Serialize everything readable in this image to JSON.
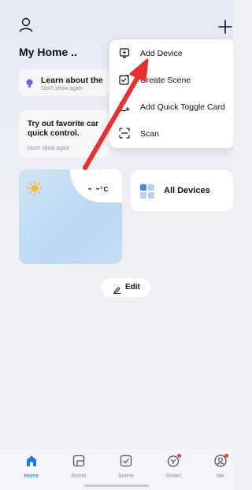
{
  "header": {
    "home_title": "My Home ..",
    "profile_icon": "user-icon",
    "add_icon": "plus-icon"
  },
  "learn_card": {
    "title": "Learn about the",
    "subtitle": "Don't show again",
    "icon": "lightbulb-icon"
  },
  "favorites_card": {
    "title_line1": "Try out favorite car",
    "title_line2": "quick control.",
    "subtitle": "Don't show again"
  },
  "weather": {
    "temperature": "- -",
    "unit": "°C",
    "dash1": "- -",
    "dash2": "- -",
    "icon": "sun-icon"
  },
  "all_devices": {
    "label": "All Devices",
    "icon": "grid-icon"
  },
  "edit": {
    "label": "Edit",
    "icon": "pencil-icon"
  },
  "menu": {
    "items": [
      {
        "label": "Add Device",
        "icon": "add-device-icon"
      },
      {
        "label": "Create Scene",
        "icon": "create-scene-icon"
      },
      {
        "label": "Add Quick Toggle Card",
        "icon": "quick-toggle-icon"
      },
      {
        "label": "Scan",
        "icon": "scan-icon"
      }
    ]
  },
  "tabs": [
    {
      "label": "Home",
      "icon": "home-icon",
      "active": true
    },
    {
      "label": "Room",
      "icon": "room-icon",
      "active": false
    },
    {
      "label": "Scene",
      "icon": "scene-icon",
      "active": false
    },
    {
      "label": "Smart",
      "icon": "smart-icon",
      "active": false
    },
    {
      "label": "Me",
      "icon": "me-icon",
      "active": false
    }
  ],
  "colors": {
    "accent": "#1877f2",
    "annotation_arrow": "#e8302e",
    "badge": "#f5433f"
  }
}
